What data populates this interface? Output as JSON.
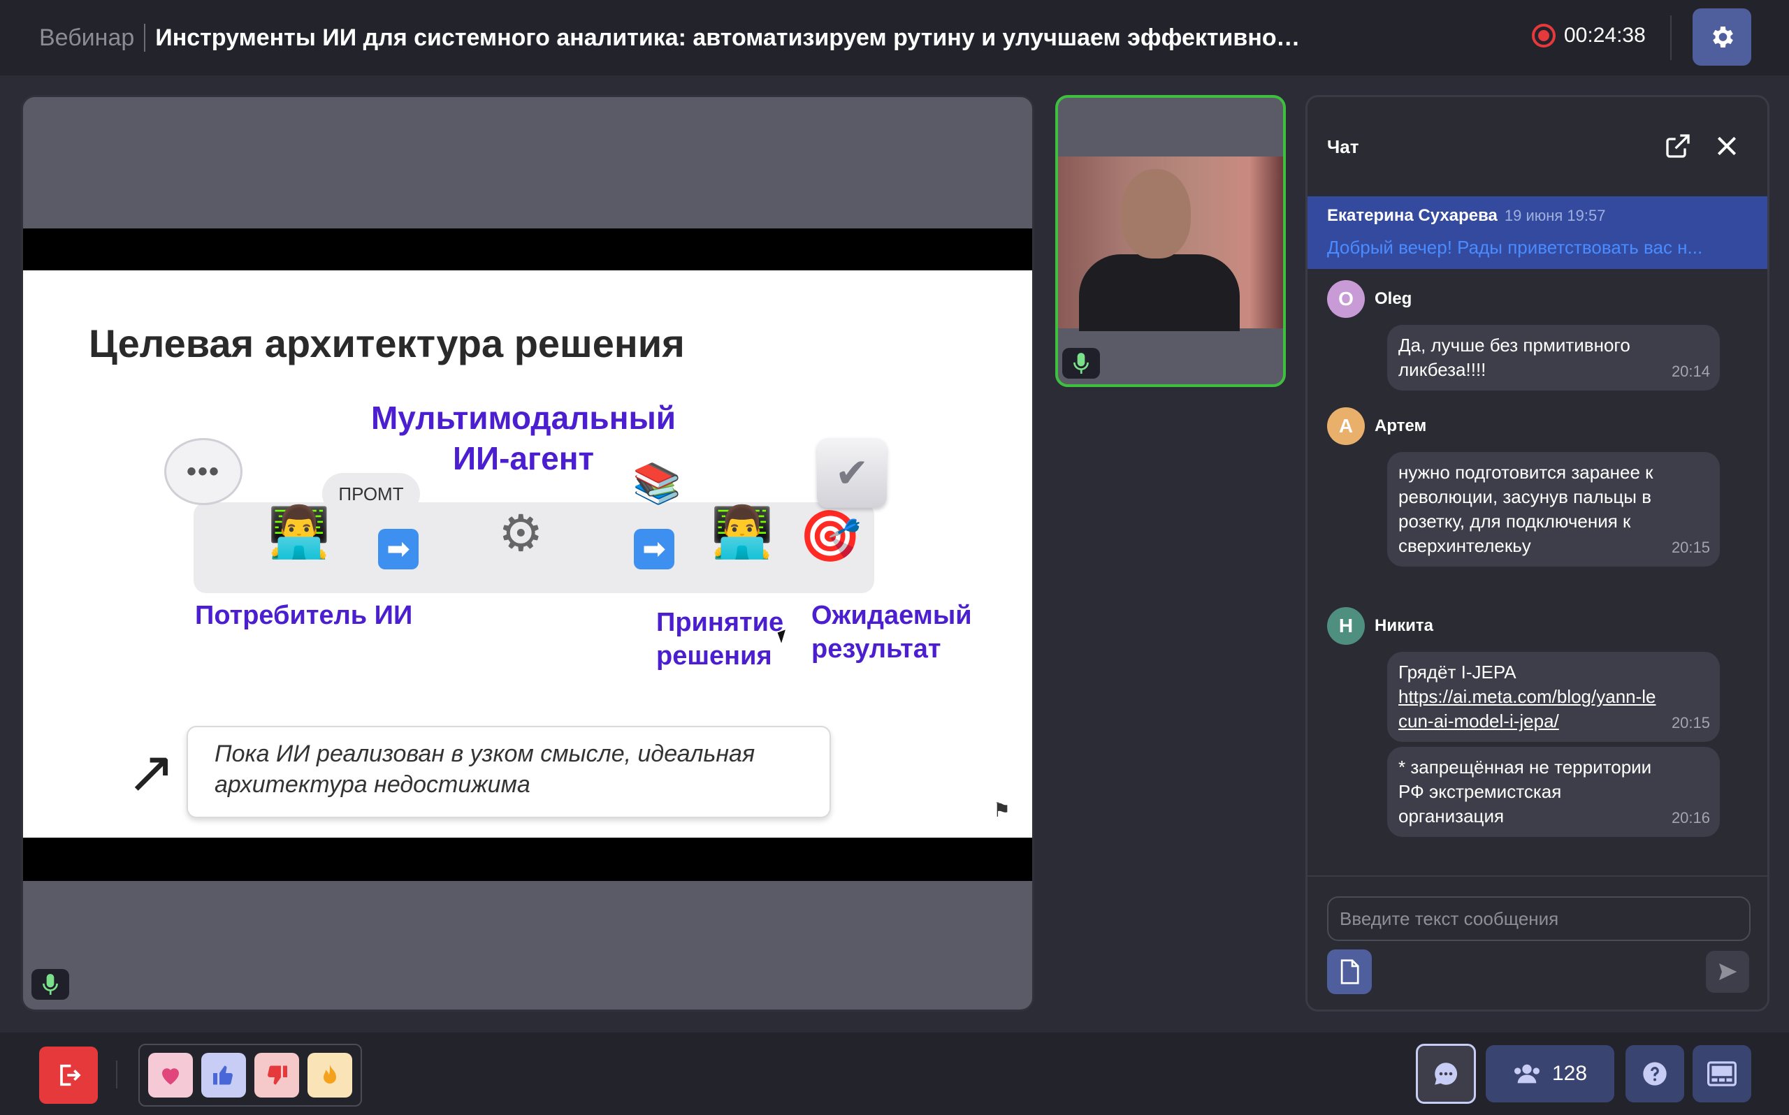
{
  "header": {
    "label": "Вебинар",
    "title": "Инструменты ИИ для системного аналитика: автоматизируем рутину и улучшаем эффективность ...",
    "timer": "00:24:38"
  },
  "slide": {
    "title": "Целевая архитектура решения",
    "agent_label_line1": "Мультимодальный",
    "agent_label_line2": "ИИ-агент",
    "prompt_bubble": "ПРОМТ",
    "consumer_label": "Потребитель ИИ",
    "decision_line1": "Принятие",
    "decision_line2": "решения",
    "result_line1": "Ожидаемый",
    "result_line2": "результат",
    "note_line1": "Пока ИИ реализован в узком смысле, идеальная",
    "note_line2": "архитектура недостижима"
  },
  "chat": {
    "title": "Чат",
    "pinned": {
      "author": "Екатерина Сухарева",
      "time": "19 июня 19:57",
      "text": "Добрый вечер! Рады приветствовать вас н..."
    },
    "messages": [
      {
        "initial": "O",
        "author": "Oleg",
        "color": "#c89ad6",
        "text": "Да, лучше без прмитивного ликбеза!!!!",
        "time": "20:14"
      },
      {
        "initial": "А",
        "author": "Артем",
        "color": "#e8b06a",
        "text": "нужно подготовится заранее к революции, засунув пальцы в розетку, для подключения к сверхинтелекьу",
        "time": "20:15"
      },
      {
        "initial": "Н",
        "author": "Никита",
        "color": "#4f8f7f",
        "text": "Грядёт I-JEPA",
        "link": "https://ai.meta.com/blog/yann-lecun-ai-model-i-jepa/",
        "time": "20:15"
      },
      {
        "text": "* запрещённая не территории РФ экстремистская организация",
        "time": "20:16"
      }
    ],
    "input_placeholder": "Введите текст сообщения"
  },
  "bottom": {
    "participants_count": "128"
  },
  "colors": {
    "accent": "#4f5f9e",
    "record": "#e5393b",
    "slide_label": "#4b1fd0",
    "pinned_bg": "#334a9e",
    "speaker_border": "#3fbf3f"
  },
  "icons": {
    "settings": "gear-icon",
    "exit": "exit-icon",
    "mic": "microphone-icon",
    "open_external": "external-link-icon",
    "close": "close-icon",
    "attach": "file-icon",
    "send": "send-icon",
    "chat": "chat-icon",
    "participants": "people-icon",
    "help": "help-icon",
    "layout": "layout-icon"
  }
}
